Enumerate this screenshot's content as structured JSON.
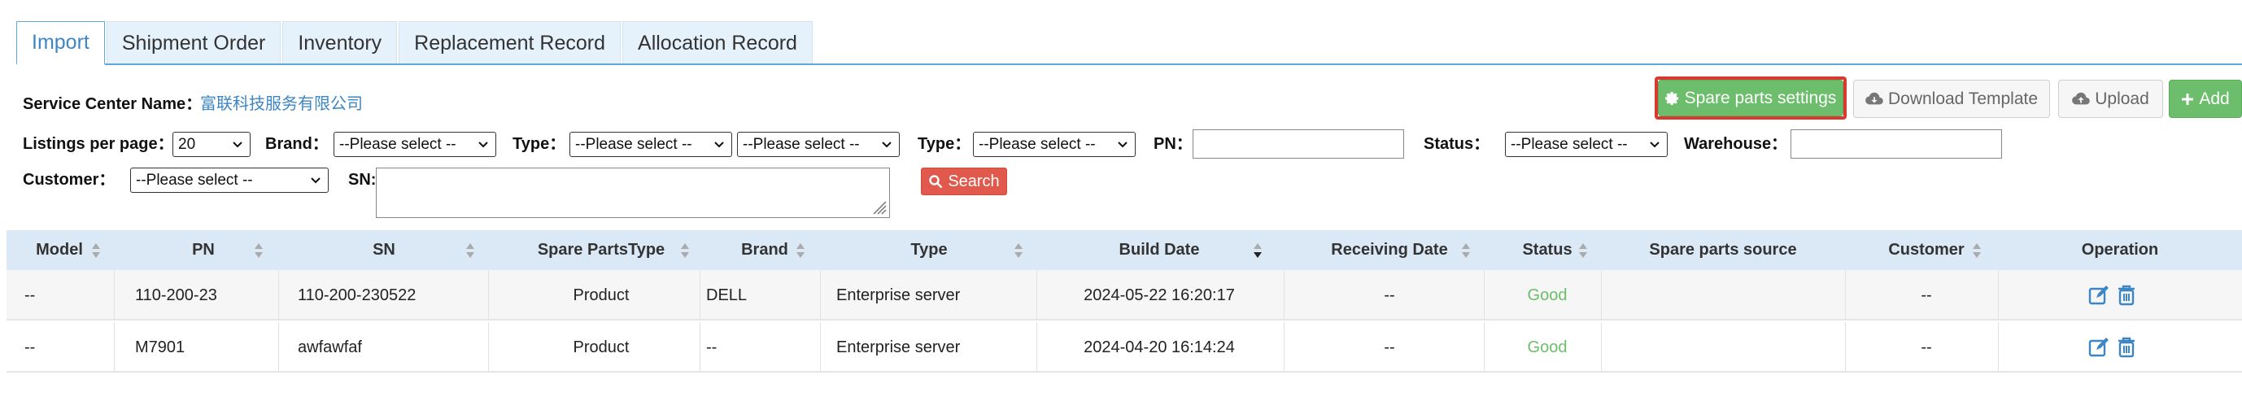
{
  "tabs": [
    {
      "label": "Import",
      "active": true
    },
    {
      "label": "Shipment Order",
      "active": false
    },
    {
      "label": "Inventory",
      "active": false
    },
    {
      "label": "Replacement Record",
      "active": false
    },
    {
      "label": "Allocation Record",
      "active": false
    }
  ],
  "service_center": {
    "label": "Service Center Name：",
    "value": "富联科技服务有限公司"
  },
  "actions": {
    "spare_parts_settings": "Spare parts settings",
    "download_template": "Download Template",
    "upload": "Upload",
    "add": "Add"
  },
  "filters": {
    "listings_label": "Listings per page：",
    "listings_value": "20",
    "brand_label": "Brand：",
    "brand_value": "--Please select --",
    "type1_label": "Type：",
    "type1_value_a": "--Please select --",
    "type1_value_b": "--Please select --",
    "type2_label": "Type：",
    "type2_value": "--Please select --",
    "pn_label": "PN：",
    "pn_value": "",
    "status_label": "Status：",
    "status_value": "--Please select --",
    "warehouse_label": "Warehouse：",
    "warehouse_value": "",
    "customer_label": "Customer：",
    "customer_value": "--Please select --",
    "sn_label": "SN:",
    "sn_value": "",
    "search_label": "Search"
  },
  "table": {
    "columns": [
      "Model",
      "PN",
      "SN",
      "Spare PartsType",
      "Brand",
      "Type",
      "Build Date",
      "Receiving Date",
      "Status",
      "Spare parts source",
      "Customer",
      "Operation"
    ],
    "rows": [
      {
        "model": "--",
        "pn": "110-200-23",
        "sn": "110-200-230522",
        "spare_type": "Product",
        "brand": "DELL",
        "type": "Enterprise server",
        "build_date": "2024-05-22 16:20:17",
        "receiving_date": "--",
        "status": "Good",
        "source": "",
        "customer": "--"
      },
      {
        "model": "--",
        "pn": "M7901",
        "sn": "awfawfaf",
        "spare_type": "Product",
        "brand": "--",
        "type": "Enterprise server",
        "build_date": "2024-04-20 16:14:24",
        "receiving_date": "--",
        "status": "Good",
        "source": "",
        "customer": "--"
      }
    ]
  },
  "colors": {
    "accent": "#3d86c6",
    "green": "#6cbe6c",
    "red": "#e0594c",
    "header_bg": "#dbe9f7"
  },
  "icons": [
    "gear-icon",
    "cloud-download-icon",
    "cloud-upload-icon",
    "plus-icon",
    "search-icon",
    "sort-icon",
    "edit-icon",
    "trash-icon",
    "chevron-down-icon"
  ]
}
